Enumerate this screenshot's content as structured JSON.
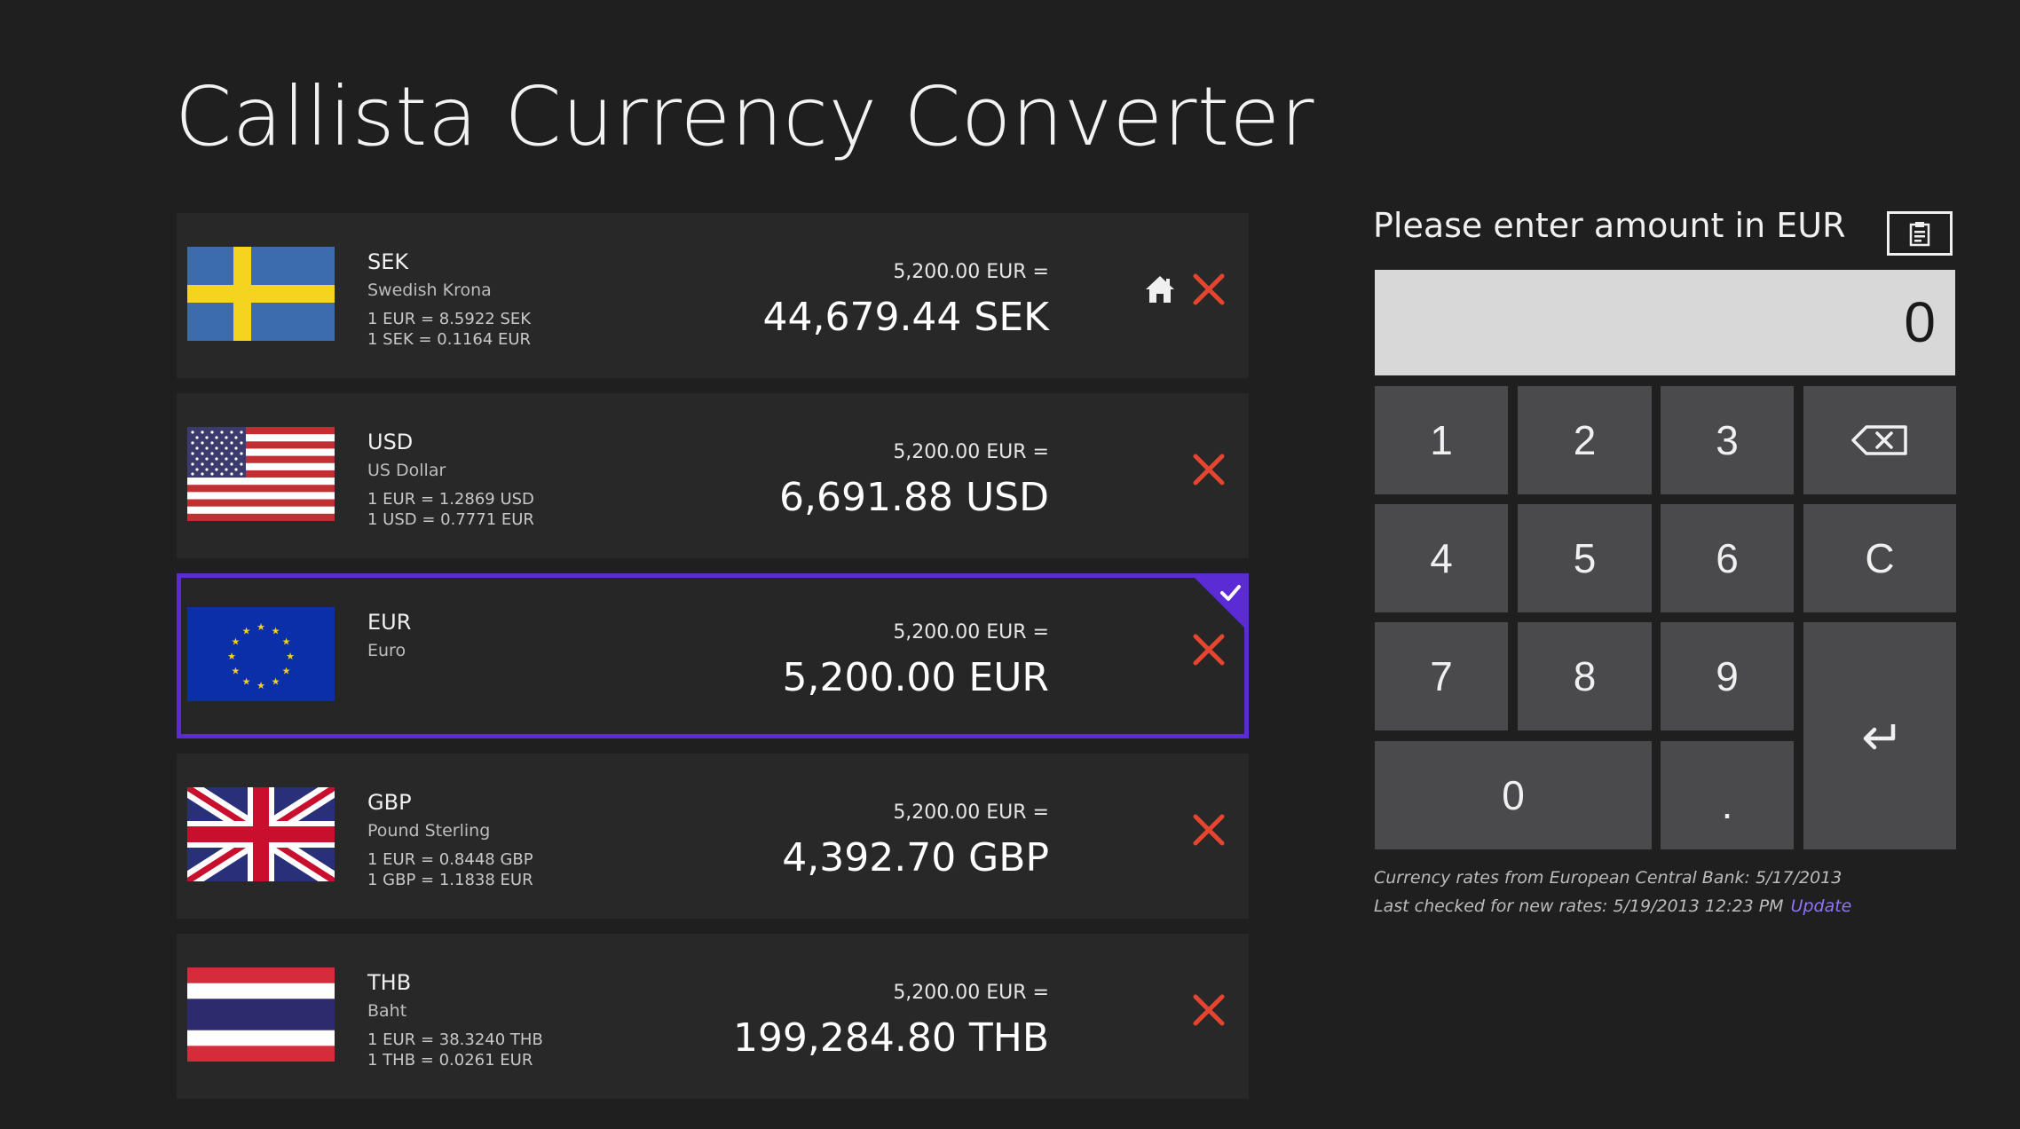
{
  "app": {
    "title": "Callista Currency Converter"
  },
  "currencies": [
    {
      "code": "SEK",
      "name": "Swedish Krona",
      "rate_line_1": "1 EUR = 8.5922 SEK",
      "rate_line_2": "1 SEK = 0.1164 EUR",
      "base_amount": "5,200.00 EUR =",
      "converted": "44,679.44 SEK",
      "is_home": true,
      "selected": false,
      "flag_icon": "sweden-flag-icon"
    },
    {
      "code": "USD",
      "name": "US Dollar",
      "rate_line_1": "1 EUR = 1.2869 USD",
      "rate_line_2": "1 USD = 0.7771 EUR",
      "base_amount": "5,200.00 EUR =",
      "converted": "6,691.88 USD",
      "is_home": false,
      "selected": false,
      "flag_icon": "usa-flag-icon"
    },
    {
      "code": "EUR",
      "name": "Euro",
      "rate_line_1": "",
      "rate_line_2": "",
      "base_amount": "5,200.00 EUR =",
      "converted": "5,200.00 EUR",
      "is_home": false,
      "selected": true,
      "flag_icon": "eu-flag-icon"
    },
    {
      "code": "GBP",
      "name": "Pound Sterling",
      "rate_line_1": "1 EUR = 0.8448 GBP",
      "rate_line_2": "1 GBP = 1.1838 EUR",
      "base_amount": "5,200.00 EUR =",
      "converted": "4,392.70 GBP",
      "is_home": false,
      "selected": false,
      "flag_icon": "uk-flag-icon"
    },
    {
      "code": "THB",
      "name": "Baht",
      "rate_line_1": "1 EUR = 38.3240 THB",
      "rate_line_2": "1 THB = 0.0261 EUR",
      "base_amount": "5,200.00 EUR =",
      "converted": "199,284.80 THB",
      "is_home": false,
      "selected": false,
      "flag_icon": "thailand-flag-icon"
    }
  ],
  "keypad": {
    "prompt": "Please enter amount in EUR",
    "display_value": "0",
    "paste_icon": "clipboard-icon",
    "keys": {
      "k1": "1",
      "k2": "2",
      "k3": "3",
      "k4": "4",
      "k5": "5",
      "k6": "6",
      "k7": "7",
      "k8": "8",
      "k9": "9",
      "k0": "0",
      "dot": ".",
      "clear": "C"
    },
    "backspace_icon": "backspace-icon",
    "enter_icon": "enter-icon"
  },
  "footer": {
    "rates_source": "Currency rates from European Central Bank: 5/17/2013",
    "last_checked": "Last checked for new rates:  5/19/2013 12:23 PM",
    "update_label": "Update"
  },
  "colors": {
    "background": "#1f1f1f",
    "row_background": "#282828",
    "accent": "#5b2bd6",
    "remove": "#e5452f",
    "key_background": "#4a4a4d",
    "display_background": "#d8d8d8",
    "link": "#8f74ff"
  },
  "icons": {
    "home": "home-icon",
    "remove": "close-icon",
    "selected": "check-icon"
  }
}
